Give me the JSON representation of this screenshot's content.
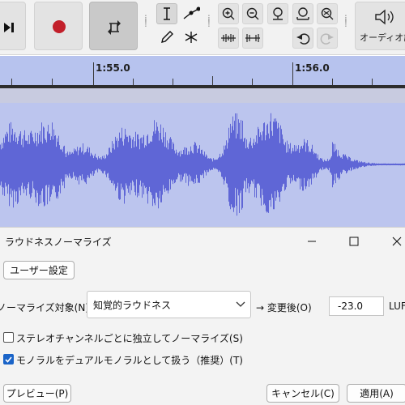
{
  "toolbar": {
    "audio_setup_label": "オーディオ設定"
  },
  "timeline": {
    "tick_1": "1:55.0",
    "tick_2": "1:56.0"
  },
  "dialog": {
    "title": "ラウドネスノーマライズ",
    "user_preset_button": "ユーザー設定",
    "normalize_label": "ノーマライズ対象(N)",
    "normalize_selected": "知覚的ラウドネス",
    "arrow_label": "→ 変更後(O)",
    "target_value": "-23.0",
    "unit": "LUFS",
    "option_stereo_label": "ステレオチャンネルごとに独立してノーマライズ(S)",
    "option_stereo_checked": false,
    "option_mono_label": "モノラルをデュアルモノラルとして扱う（推奨）(T)",
    "option_mono_checked": true,
    "preview_button": "プレビュー(P)",
    "cancel_button": "キャンセル(C)",
    "apply_button": "適用(A)"
  },
  "colors": {
    "waveform": "#5f66d6",
    "waveform_bg": "#bcc5ee",
    "timeline_bg": "#b7c3ee",
    "record": "#c21f2a",
    "checkbox_checked": "#1a64c8"
  },
  "icons": [
    "skip-to-end-icon",
    "record-icon",
    "loop-icon",
    "selection-tool-icon",
    "envelope-tool-icon",
    "draw-tool-icon",
    "multi-tool-icon",
    "zoom-in-icon",
    "zoom-out-icon",
    "fit-selection-icon",
    "fit-project-icon",
    "zoom-toggle-icon",
    "trim-icon",
    "silence-icon",
    "undo-icon",
    "redo-icon",
    "speaker-icon",
    "minimize-icon",
    "maximize-icon",
    "close-icon",
    "chevron-down-icon",
    "checkmark-icon"
  ]
}
